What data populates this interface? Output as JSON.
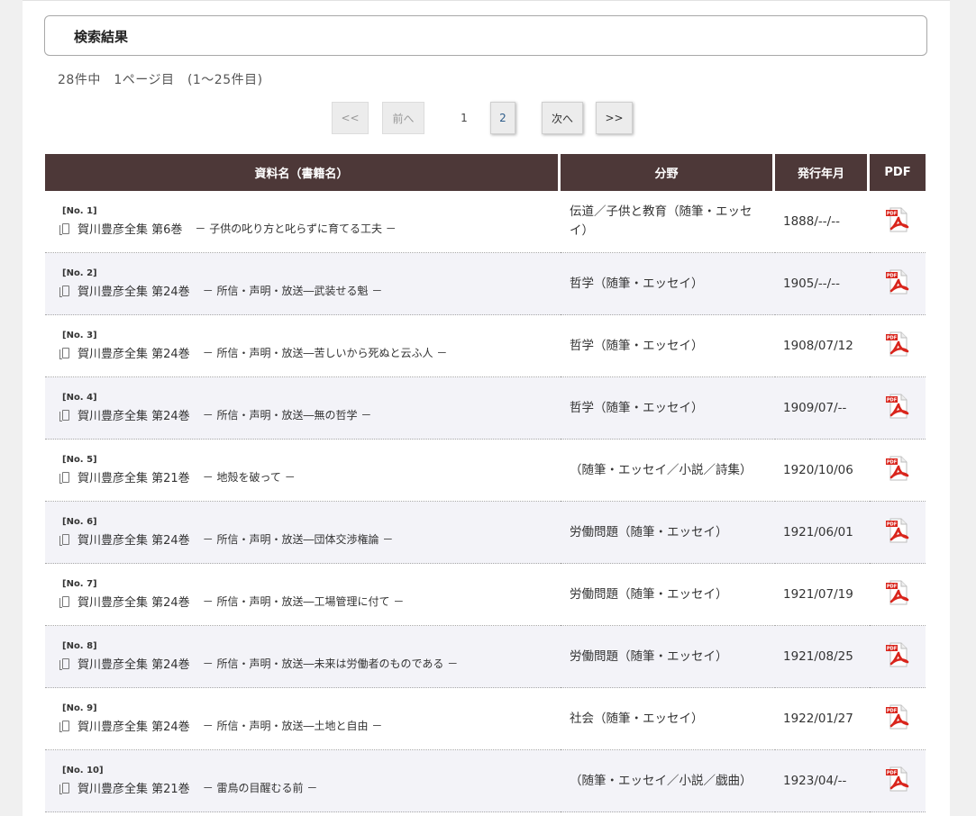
{
  "result_box": {
    "title": "検索結果"
  },
  "summary": "28件中　1ページ目　(1～25件目)",
  "pagination": {
    "first": "<<",
    "prev": "前へ",
    "current": "1",
    "page2": "2",
    "next": "次へ",
    "last": ">>"
  },
  "table": {
    "headers": [
      "資料名（書籍名）",
      "分野",
      "発行年月",
      "PDF"
    ],
    "rows": [
      {
        "no": "[No. 1]",
        "vol": "賀川豊彦全集 第6巻",
        "sub": "－ 子供の叱り方と叱らずに育てる工夫 －",
        "field": "伝道／子供と教育（随筆・エッセイ）",
        "date": "1888/--/--"
      },
      {
        "no": "[No. 2]",
        "vol": "賀川豊彦全集 第24巻",
        "sub": "－ 所信・声明・放送―武装せる魁 －",
        "field": "哲学（随筆・エッセイ）",
        "date": "1905/--/--"
      },
      {
        "no": "[No. 3]",
        "vol": "賀川豊彦全集 第24巻",
        "sub": "－ 所信・声明・放送―苦しいから死ぬと云ふ人 －",
        "field": "哲学（随筆・エッセイ）",
        "date": "1908/07/12"
      },
      {
        "no": "[No. 4]",
        "vol": "賀川豊彦全集 第24巻",
        "sub": "－ 所信・声明・放送―無の哲学 －",
        "field": "哲学（随筆・エッセイ）",
        "date": "1909/07/--"
      },
      {
        "no": "[No. 5]",
        "vol": "賀川豊彦全集 第21巻",
        "sub": "－ 地殻を破って －",
        "field": "（随筆・エッセイ／小説／詩集）",
        "date": "1920/10/06"
      },
      {
        "no": "[No. 6]",
        "vol": "賀川豊彦全集 第24巻",
        "sub": "－ 所信・声明・放送―団体交渉権論 －",
        "field": "労働問題（随筆・エッセイ）",
        "date": "1921/06/01"
      },
      {
        "no": "[No. 7]",
        "vol": "賀川豊彦全集 第24巻",
        "sub": "－ 所信・声明・放送―工場管理に付て －",
        "field": "労働問題（随筆・エッセイ）",
        "date": "1921/07/19"
      },
      {
        "no": "[No. 8]",
        "vol": "賀川豊彦全集 第24巻",
        "sub": "－ 所信・声明・放送―未来は労働者のものである －",
        "field": "労働問題（随筆・エッセイ）",
        "date": "1921/08/25"
      },
      {
        "no": "[No. 9]",
        "vol": "賀川豊彦全集 第24巻",
        "sub": "－ 所信・声明・放送―土地と自由 －",
        "field": "社会（随筆・エッセイ）",
        "date": "1922/01/27"
      },
      {
        "no": "[No. 10]",
        "vol": "賀川豊彦全集 第21巻",
        "sub": "－ 雷鳥の目醒むる前 －",
        "field": "（随筆・エッセイ／小説／戯曲）",
        "date": "1923/04/--"
      }
    ]
  },
  "colors": {
    "header_bg": "#4d3838",
    "row_alt": "#f3f3f8",
    "pdf_red": "#d9251c"
  }
}
